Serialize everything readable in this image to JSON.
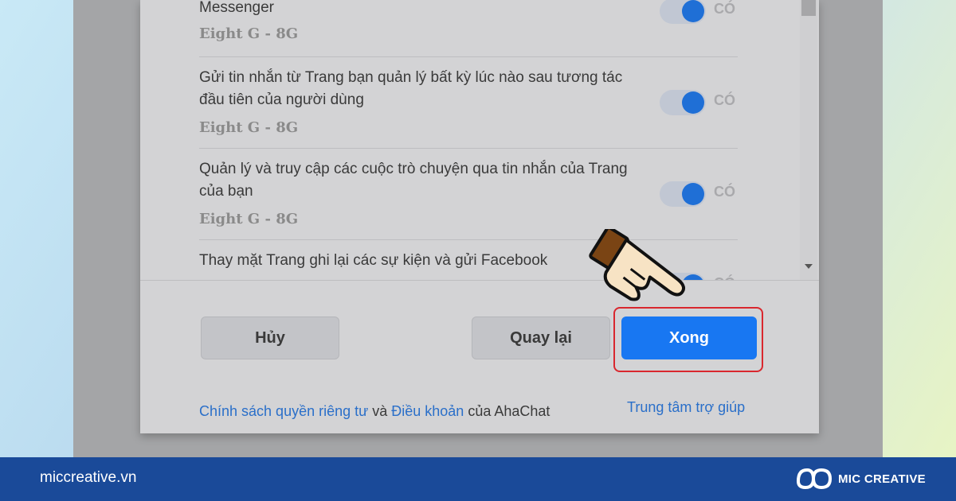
{
  "permissions": [
    {
      "title": "Messenger",
      "app": "Eight G - 8G",
      "toggle_on": true,
      "toggle_label": "CÓ"
    },
    {
      "title": "Gửi tin nhắn từ Trang bạn quản lý bất kỳ lúc nào sau tương tác đầu tiên của người dùng",
      "app": "Eight G - 8G",
      "toggle_on": true,
      "toggle_label": "CÓ"
    },
    {
      "title": "Quản lý và truy cập các cuộc trò chuyện qua tin nhắn của Trang của bạn",
      "app": "Eight G - 8G",
      "toggle_on": true,
      "toggle_label": "CÓ"
    },
    {
      "title": "Thay mặt Trang ghi lại các sự kiện và gửi Facebook",
      "app": "",
      "toggle_on": true,
      "toggle_label": "CÓ"
    }
  ],
  "buttons": {
    "cancel": "Hủy",
    "back": "Quay lại",
    "done": "Xong"
  },
  "footer": {
    "privacy_link": "Chính sách quyền riêng tư",
    "and": "và",
    "terms_link": "Điều khoản",
    "of_app": "của AhaChat",
    "help_link": "Trung tâm trợ giúp"
  },
  "banner": {
    "site": "miccreative.vn",
    "brand": "MIC CREATIVE"
  },
  "colors": {
    "primary_button": "#1877f2",
    "highlight_border": "#d9272e",
    "toggle_knob": "#1f6fd6",
    "banner_bg": "#1a4a99"
  },
  "icons": {
    "pointer": "pointing-hand-icon",
    "logo": "mic-creative-logo-icon"
  }
}
